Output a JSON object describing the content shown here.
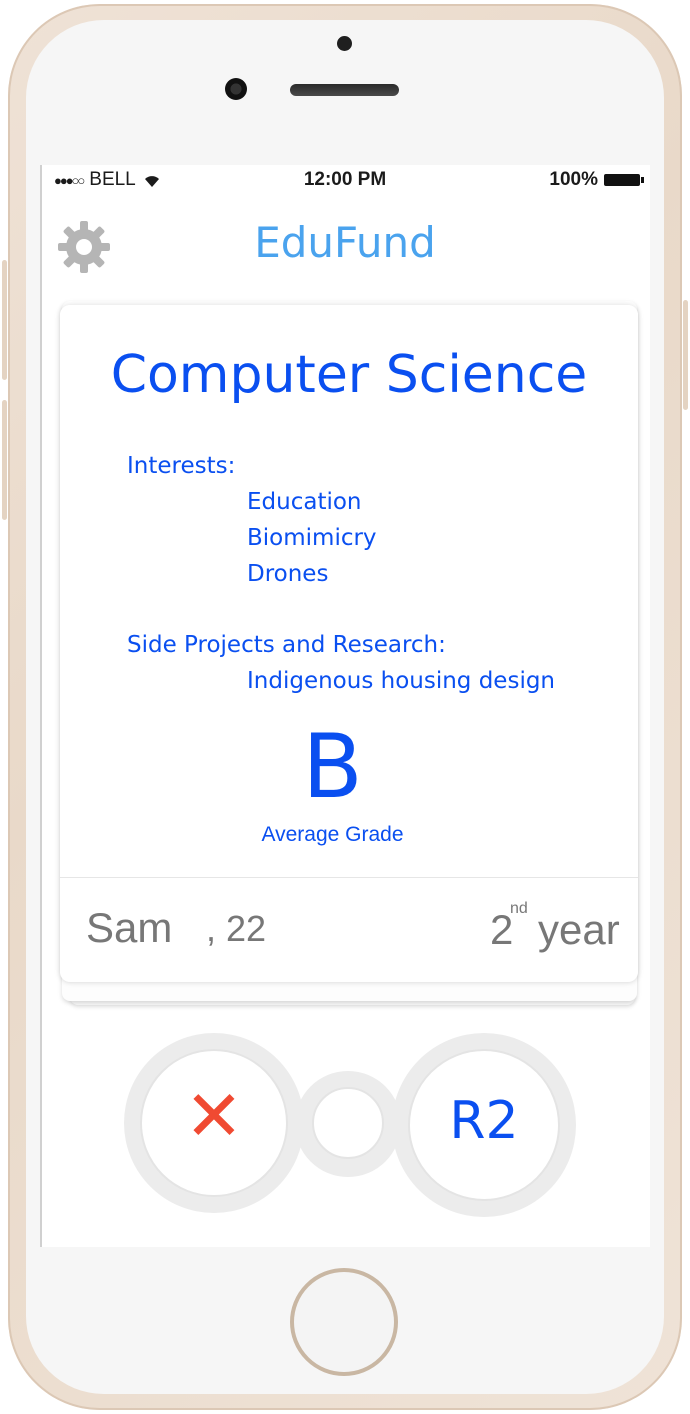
{
  "status_bar": {
    "signal": "●●●○○",
    "carrier": "BELL",
    "time": "12:00 PM",
    "battery": "100%"
  },
  "header": {
    "title": "EduFund",
    "settings_icon": "gear-icon"
  },
  "card": {
    "field": "Computer Science",
    "interests_label": "Interests:",
    "interests": [
      "Education",
      "Biomimicry",
      "Drones"
    ],
    "projects_label": "Side Projects and Research:",
    "projects": [
      "Indigenous housing design"
    ],
    "grade": "B",
    "grade_label": "Average Grade",
    "name": "Sam",
    "age_sep": ",",
    "age": "22",
    "year_number": "2",
    "year_suffix": "nd",
    "year_word": "year"
  },
  "actions": {
    "reject_icon": "close-icon",
    "reject_symbol": "✕",
    "accept_label": "R2"
  },
  "colors": {
    "accent": "#4aa3ee",
    "primary_text": "#0a4ff0",
    "reject": "#f04a32",
    "muted": "#777777"
  }
}
